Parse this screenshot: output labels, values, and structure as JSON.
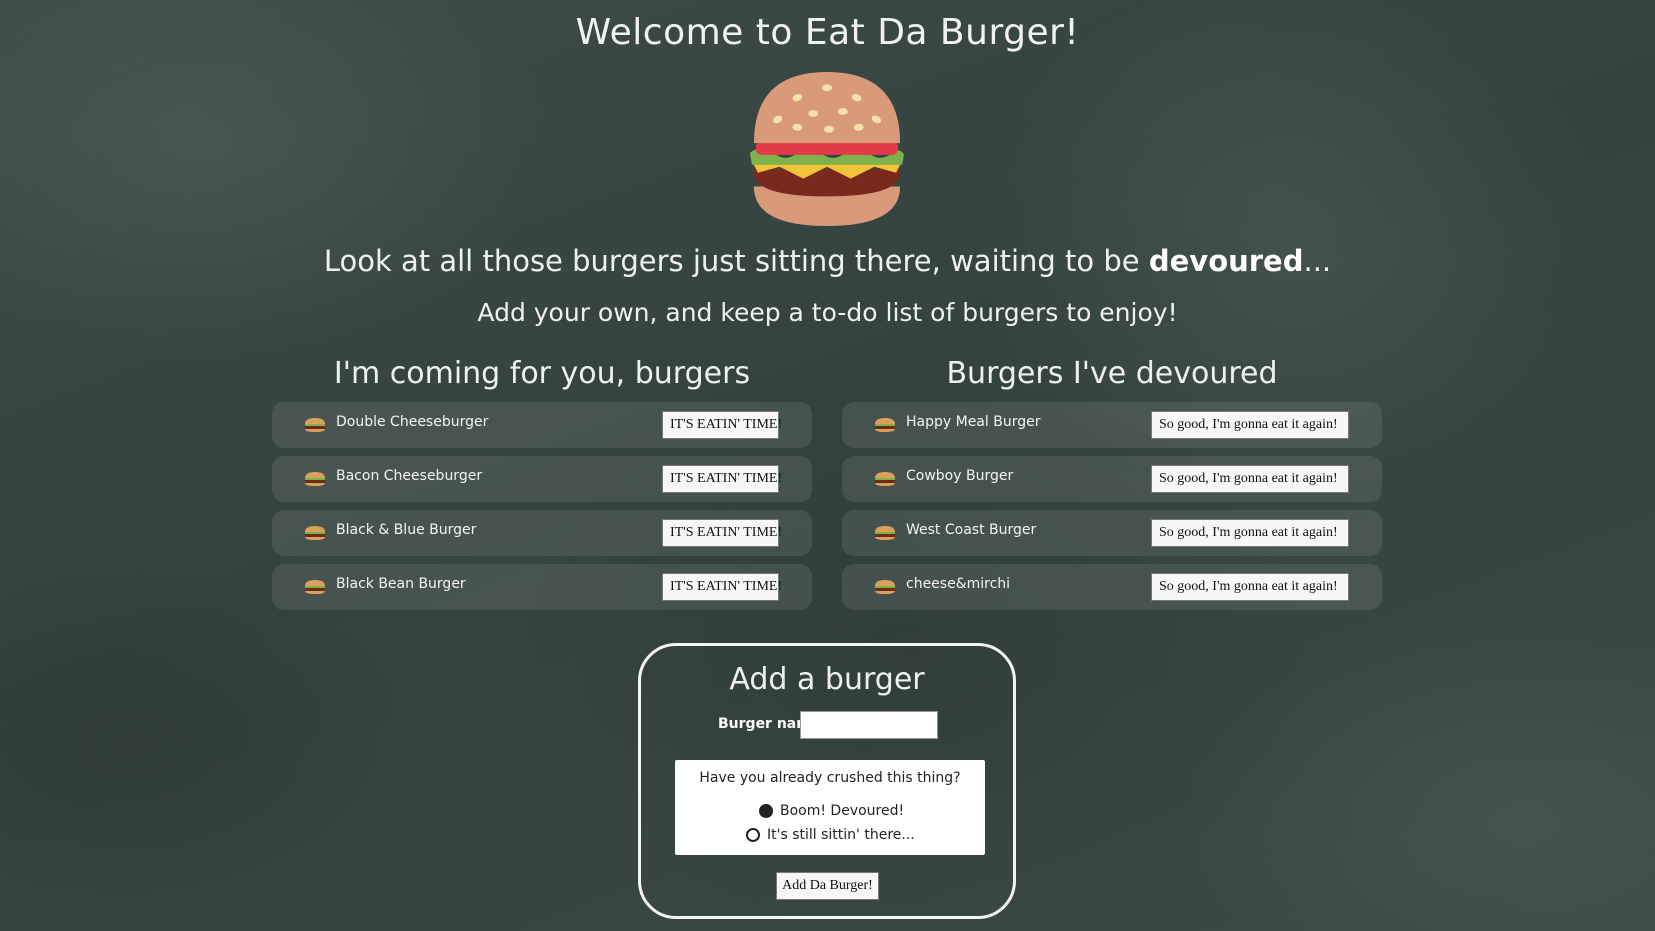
{
  "header": {
    "title": "Welcome to Eat Da Burger!",
    "logo_icon": "hamburger-icon",
    "lead_prefix": "Look at all those burgers just sitting there, waiting to be ",
    "lead_bold": "devoured",
    "lead_suffix": "...",
    "subtitle": "Add your own, and keep a to-do list of burgers to enjoy!"
  },
  "to_eat": {
    "heading": "I'm coming for you, burgers",
    "items": [
      {
        "name": "Double Cheeseburger",
        "button": "IT'S EATIN' TIME!"
      },
      {
        "name": "Bacon Cheeseburger",
        "button": "IT'S EATIN' TIME!"
      },
      {
        "name": "Black & Blue Burger",
        "button": "IT'S EATIN' TIME!"
      },
      {
        "name": "Black Bean Burger",
        "button": "IT'S EATIN' TIME!"
      }
    ]
  },
  "devoured": {
    "heading": "Burgers I've devoured",
    "items": [
      {
        "name": "Happy Meal Burger",
        "button": "So good, I'm gonna eat it again!"
      },
      {
        "name": "Cowboy Burger",
        "button": "So good, I'm gonna eat it again!"
      },
      {
        "name": "West Coast Burger",
        "button": "So good, I'm gonna eat it again!"
      },
      {
        "name": "cheese&mirchi",
        "button": "So good, I'm gonna eat it again!"
      }
    ]
  },
  "form": {
    "title": "Add a burger",
    "name_label": "Burger name",
    "name_value": "",
    "question": "Have you already crushed this thing?",
    "option_devoured": "Boom! Devoured!",
    "option_waiting": "It's still sittin' there...",
    "selected": "devoured",
    "submit_label": "Add Da Burger!"
  }
}
